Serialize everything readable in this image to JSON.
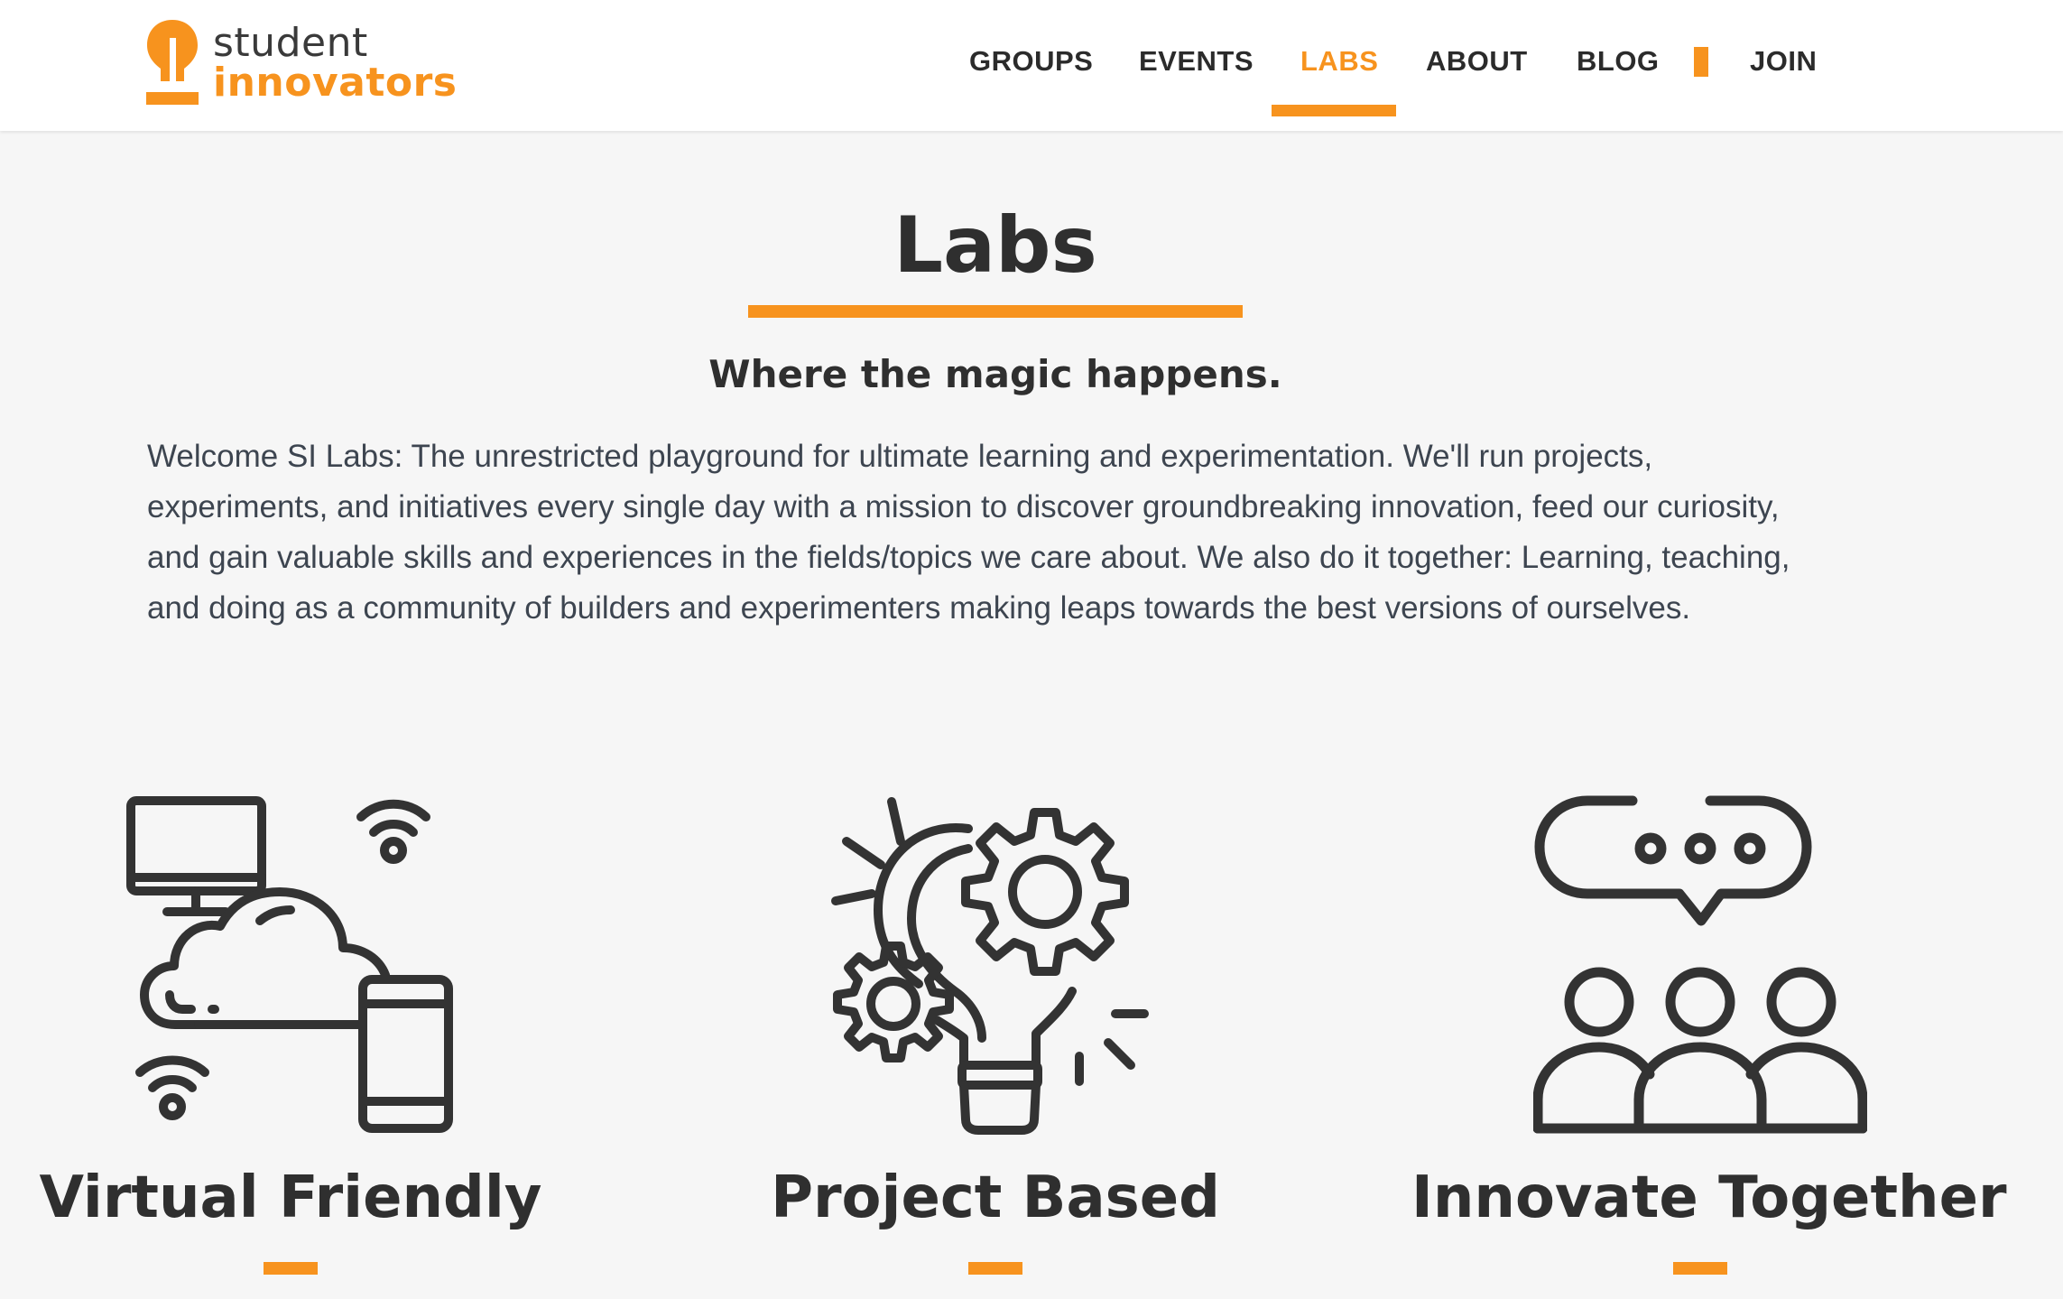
{
  "brand": {
    "line1": "student",
    "line2": "innovators",
    "accent_color": "#f7931e",
    "logo_icon": "lightbulb-icon"
  },
  "nav": {
    "items": [
      {
        "label": "GROUPS"
      },
      {
        "label": "EVENTS"
      },
      {
        "label": "LABS",
        "active": true
      },
      {
        "label": "ABOUT"
      },
      {
        "label": "BLOG"
      },
      {
        "label": "JOIN"
      }
    ]
  },
  "main": {
    "title": "Labs",
    "subtitle": "Where the magic happens.",
    "intro": "Welcome SI Labs: The unrestricted playground for ultimate learning and experimentation. We'll run projects, experiments, and initiatives every single day with a mission to discover groundbreaking innovation, feed our curiosity, and gain valuable skills and experiences in the fields/topics we care about. We also do it together: Learning, teaching, and doing as a community of builders and experimenters making leaps towards the best versions of ourselves."
  },
  "features": [
    {
      "title": "Virtual Friendly",
      "icon": "cloud-devices-icon"
    },
    {
      "title": "Project Based",
      "icon": "lightbulb-gears-icon"
    },
    {
      "title": "Innovate Together",
      "icon": "group-chat-icon"
    }
  ]
}
